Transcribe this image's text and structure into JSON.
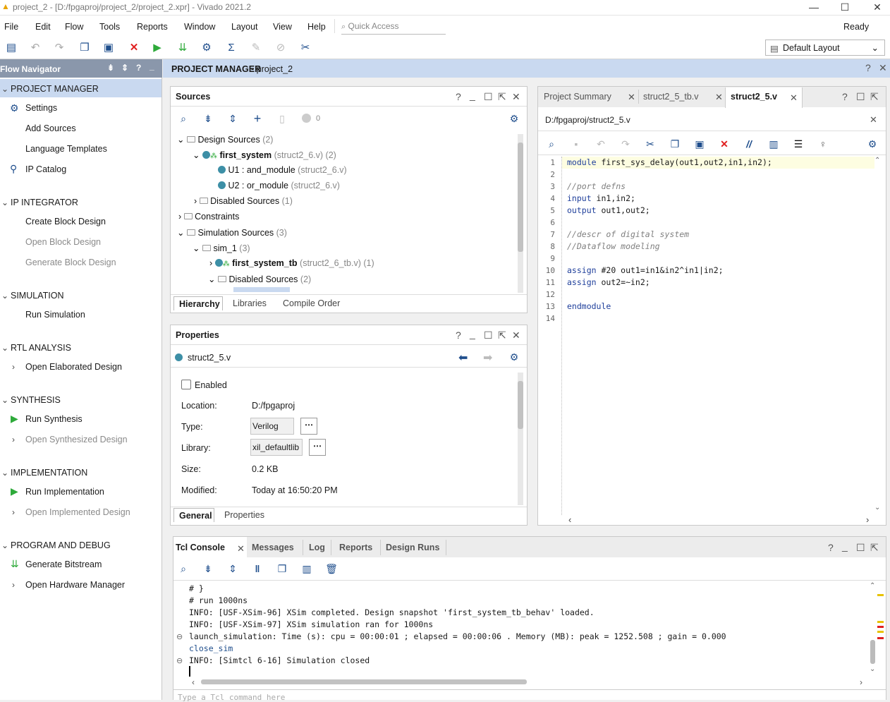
{
  "window": {
    "title": "project_2 - [D:/fpgaproj/project_2/project_2.xpr] - Vivado 2021.2",
    "minimize": "—",
    "maximize": "☐",
    "close": "✕"
  },
  "menu": [
    "File",
    "Edit",
    "Flow",
    "Tools",
    "Reports",
    "Window",
    "Layout",
    "View",
    "Help"
  ],
  "quick_access": "Quick Access",
  "status": "Ready",
  "layout_select": "Default Layout",
  "flow_navigator": {
    "title": "Flow Navigator",
    "sections": {
      "project_manager": "PROJECT MANAGER",
      "settings": "Settings",
      "add_sources": "Add Sources",
      "language_templates": "Language Templates",
      "ip_catalog": "IP Catalog",
      "ip_integrator": "IP INTEGRATOR",
      "create_block_design": "Create Block Design",
      "open_block_design": "Open Block Design",
      "generate_block_design": "Generate Block Design",
      "simulation": "SIMULATION",
      "run_simulation": "Run Simulation",
      "rtl_analysis": "RTL ANALYSIS",
      "open_elaborated_design": "Open Elaborated Design",
      "synthesis": "SYNTHESIS",
      "run_synthesis": "Run Synthesis",
      "open_synthesized_design": "Open Synthesized Design",
      "implementation": "IMPLEMENTATION",
      "run_implementation": "Run Implementation",
      "open_implemented_design": "Open Implemented Design",
      "program_debug": "PROGRAM AND DEBUG",
      "generate_bitstream": "Generate Bitstream",
      "open_hardware_manager": "Open Hardware Manager"
    }
  },
  "project_manager_bar": {
    "label": "PROJECT MANAGER",
    "project": " - project_2"
  },
  "sources": {
    "title": "Sources",
    "count": "0",
    "tree": {
      "design_sources": "Design Sources",
      "design_sources_count": "(2)",
      "first_system": "first_system",
      "first_system_file": "(struct2_6.v)",
      "first_system_count": "(2)",
      "u1": "U1 : and_module",
      "u1_file": "(struct2_6.v)",
      "u2": "U2 : or_module",
      "u2_file": "(struct2_6.v)",
      "disabled1": "Disabled Sources",
      "disabled1_count": "(1)",
      "constraints": "Constraints",
      "sim_sources": "Simulation Sources",
      "sim_sources_count": "(3)",
      "sim1": "sim_1",
      "sim1_count": "(3)",
      "tb": "first_system_tb",
      "tb_file": "(struct2_6_tb.v)",
      "tb_count": "(1)",
      "disabled2": "Disabled Sources",
      "disabled2_count": "(2)"
    },
    "tabs": [
      "Hierarchy",
      "Libraries",
      "Compile Order"
    ]
  },
  "properties": {
    "title": "Properties",
    "file": "struct2_5.v",
    "enabled": "Enabled",
    "location_label": "Location:",
    "location": "D:/fpgaproj",
    "type_label": "Type:",
    "type": "Verilog",
    "library_label": "Library:",
    "library": "xil_defaultlib",
    "size_label": "Size:",
    "size": "0.2 KB",
    "modified_label": "Modified:",
    "modified": "Today at 16:50:20 PM",
    "tabs": [
      "General",
      "Properties"
    ]
  },
  "editor": {
    "tabs": [
      "Project Summary",
      "struct2_5_tb.v",
      "struct2_5.v"
    ],
    "path": "D:/fpgaproj/struct2_5.v",
    "line_numbers": [
      "1",
      "2",
      "3",
      "4",
      "5",
      "6",
      "7",
      "8",
      "9",
      "10",
      "11",
      "12",
      "13",
      "14"
    ],
    "lines": [
      [
        {
          "k": "kw",
          "t": "module"
        },
        {
          "k": "",
          "t": " first_sys_delay(out1,out2,in1,in2);"
        }
      ],
      [],
      [
        {
          "k": "cm",
          "t": "//port defns"
        }
      ],
      [
        {
          "k": "kw",
          "t": "input"
        },
        {
          "k": "",
          "t": " in1,in2;"
        }
      ],
      [
        {
          "k": "kw",
          "t": "output"
        },
        {
          "k": "",
          "t": " out1,out2;"
        }
      ],
      [],
      [
        {
          "k": "cm",
          "t": "//descr of digital system"
        }
      ],
      [
        {
          "k": "cm",
          "t": "//Dataflow modeling"
        }
      ],
      [],
      [
        {
          "k": "kw",
          "t": "assign"
        },
        {
          "k": "",
          "t": " #20 out1=in1&in2^in1|in2;"
        }
      ],
      [
        {
          "k": "kw",
          "t": "assign"
        },
        {
          "k": "",
          "t": " out2=~in2;"
        }
      ],
      [],
      [
        {
          "k": "kw",
          "t": "endmodule"
        }
      ],
      []
    ]
  },
  "console": {
    "tabs": [
      "Tcl Console",
      "Messages",
      "Log",
      "Reports",
      "Design Runs"
    ],
    "lines": [
      "# }",
      "# run 1000ns",
      "INFO: [USF-XSim-96] XSim completed. Design snapshot 'first_system_tb_behav' loaded.",
      "INFO: [USF-XSim-97] XSim simulation ran for 1000ns",
      "launch_simulation: Time (s): cpu = 00:00:01 ; elapsed = 00:00:06 . Memory (MB): peak = 1252.508 ; gain = 0.000",
      "close_sim",
      "INFO: [Simtcl 6-16] Simulation closed"
    ],
    "input_placeholder": "Type a Tcl command here"
  },
  "colors": {
    "accent": "#1f4e8c",
    "run_green": "#2eaa3a",
    "stop_red": "#e02020",
    "selection": "#c9d9f0"
  }
}
